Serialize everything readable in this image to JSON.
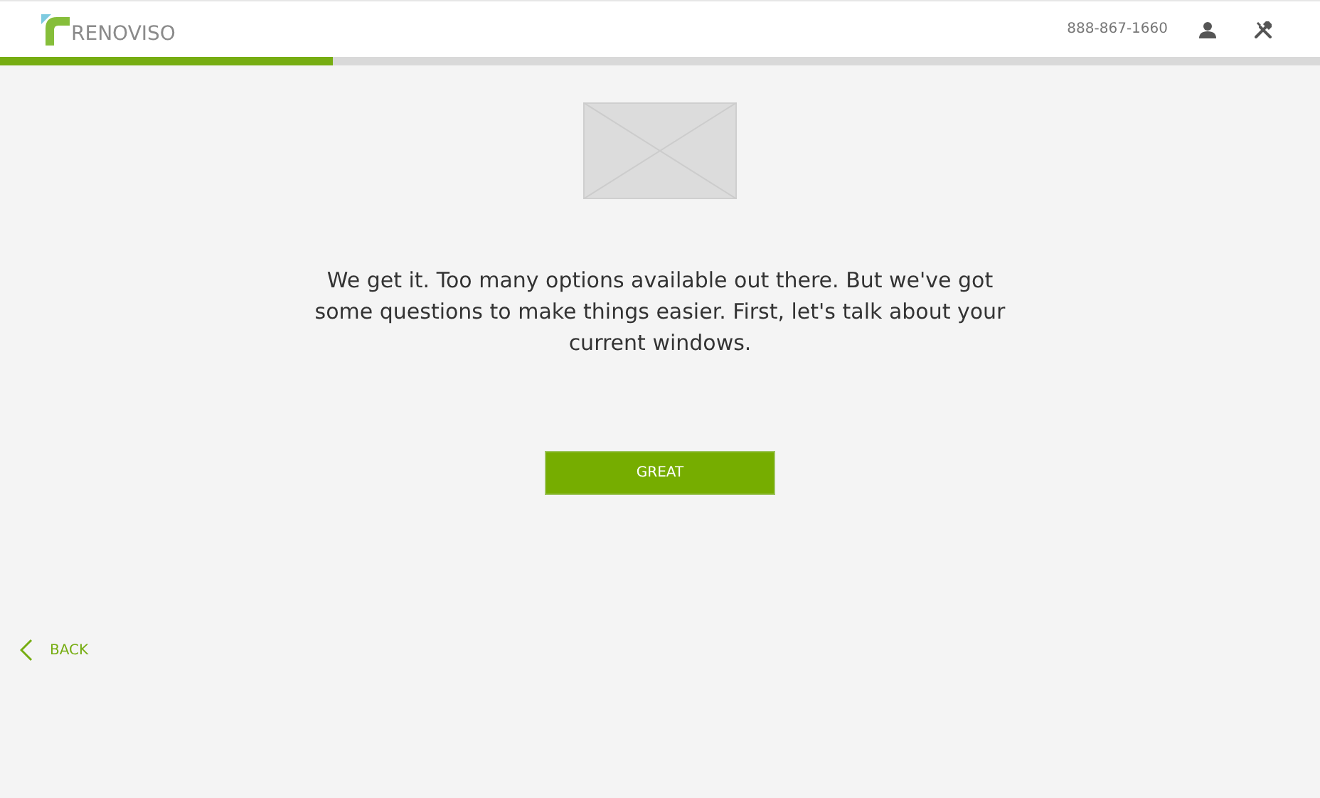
{
  "header": {
    "logo": "RENOVISO",
    "phone": "888-867-1660"
  },
  "progress": {
    "level": 0.252
  },
  "intro": "We get it. Too many options available out there. But we've got some questions to make things easier. First, let's talk about your current windows.",
  "primary_button": "GREAT",
  "back_link": "BACK"
}
